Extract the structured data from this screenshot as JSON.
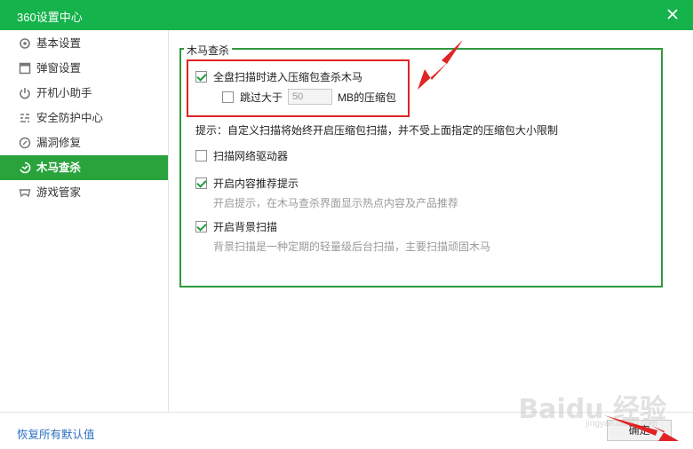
{
  "window": {
    "title": "360设置中心"
  },
  "sidebar": {
    "items": [
      {
        "label": "基本设置",
        "icon": "gear-icon"
      },
      {
        "label": "弹窗设置",
        "icon": "window-icon"
      },
      {
        "label": "开机小助手",
        "icon": "power-icon"
      },
      {
        "label": "安全防护中心",
        "icon": "shield-grid-icon"
      },
      {
        "label": "漏洞修复",
        "icon": "patch-icon"
      },
      {
        "label": "木马查杀",
        "icon": "trojan-scan-icon",
        "active": true
      },
      {
        "label": "游戏管家",
        "icon": "gamepad-icon"
      }
    ]
  },
  "group": {
    "title": "木马查杀",
    "zip_scan": {
      "label": "全盘扫描时进入压缩包查杀木马",
      "checked": true
    },
    "skip_large": {
      "prefix": "跳过大于",
      "value": "50",
      "suffix": "MB的压缩包",
      "checked": false
    },
    "hint": "提示：自定义扫描将始终开启压缩包扫描，并不受上面指定的压缩包大小限制",
    "network_drive": {
      "label": "扫描网络驱动器",
      "checked": false
    },
    "content_recommend": {
      "label": "开启内容推荐提示",
      "desc": "开启提示，在木马查杀界面显示热点内容及产品推荐",
      "checked": true
    },
    "background_scan": {
      "label": "开启背景扫描",
      "desc": "背景扫描是一种定期的轻量级后台扫描，主要扫描顽固木马",
      "checked": true
    }
  },
  "footer": {
    "reset_label": "恢复所有默认值",
    "ok_label": "确定"
  },
  "watermark": {
    "text": "Baidu 经验",
    "sub": "jingyan.baidu.com"
  },
  "colors": {
    "titlebar": "#15b34b",
    "accent": "#2aa33d",
    "annotation": "#e02424",
    "link": "#2b6fc4"
  }
}
